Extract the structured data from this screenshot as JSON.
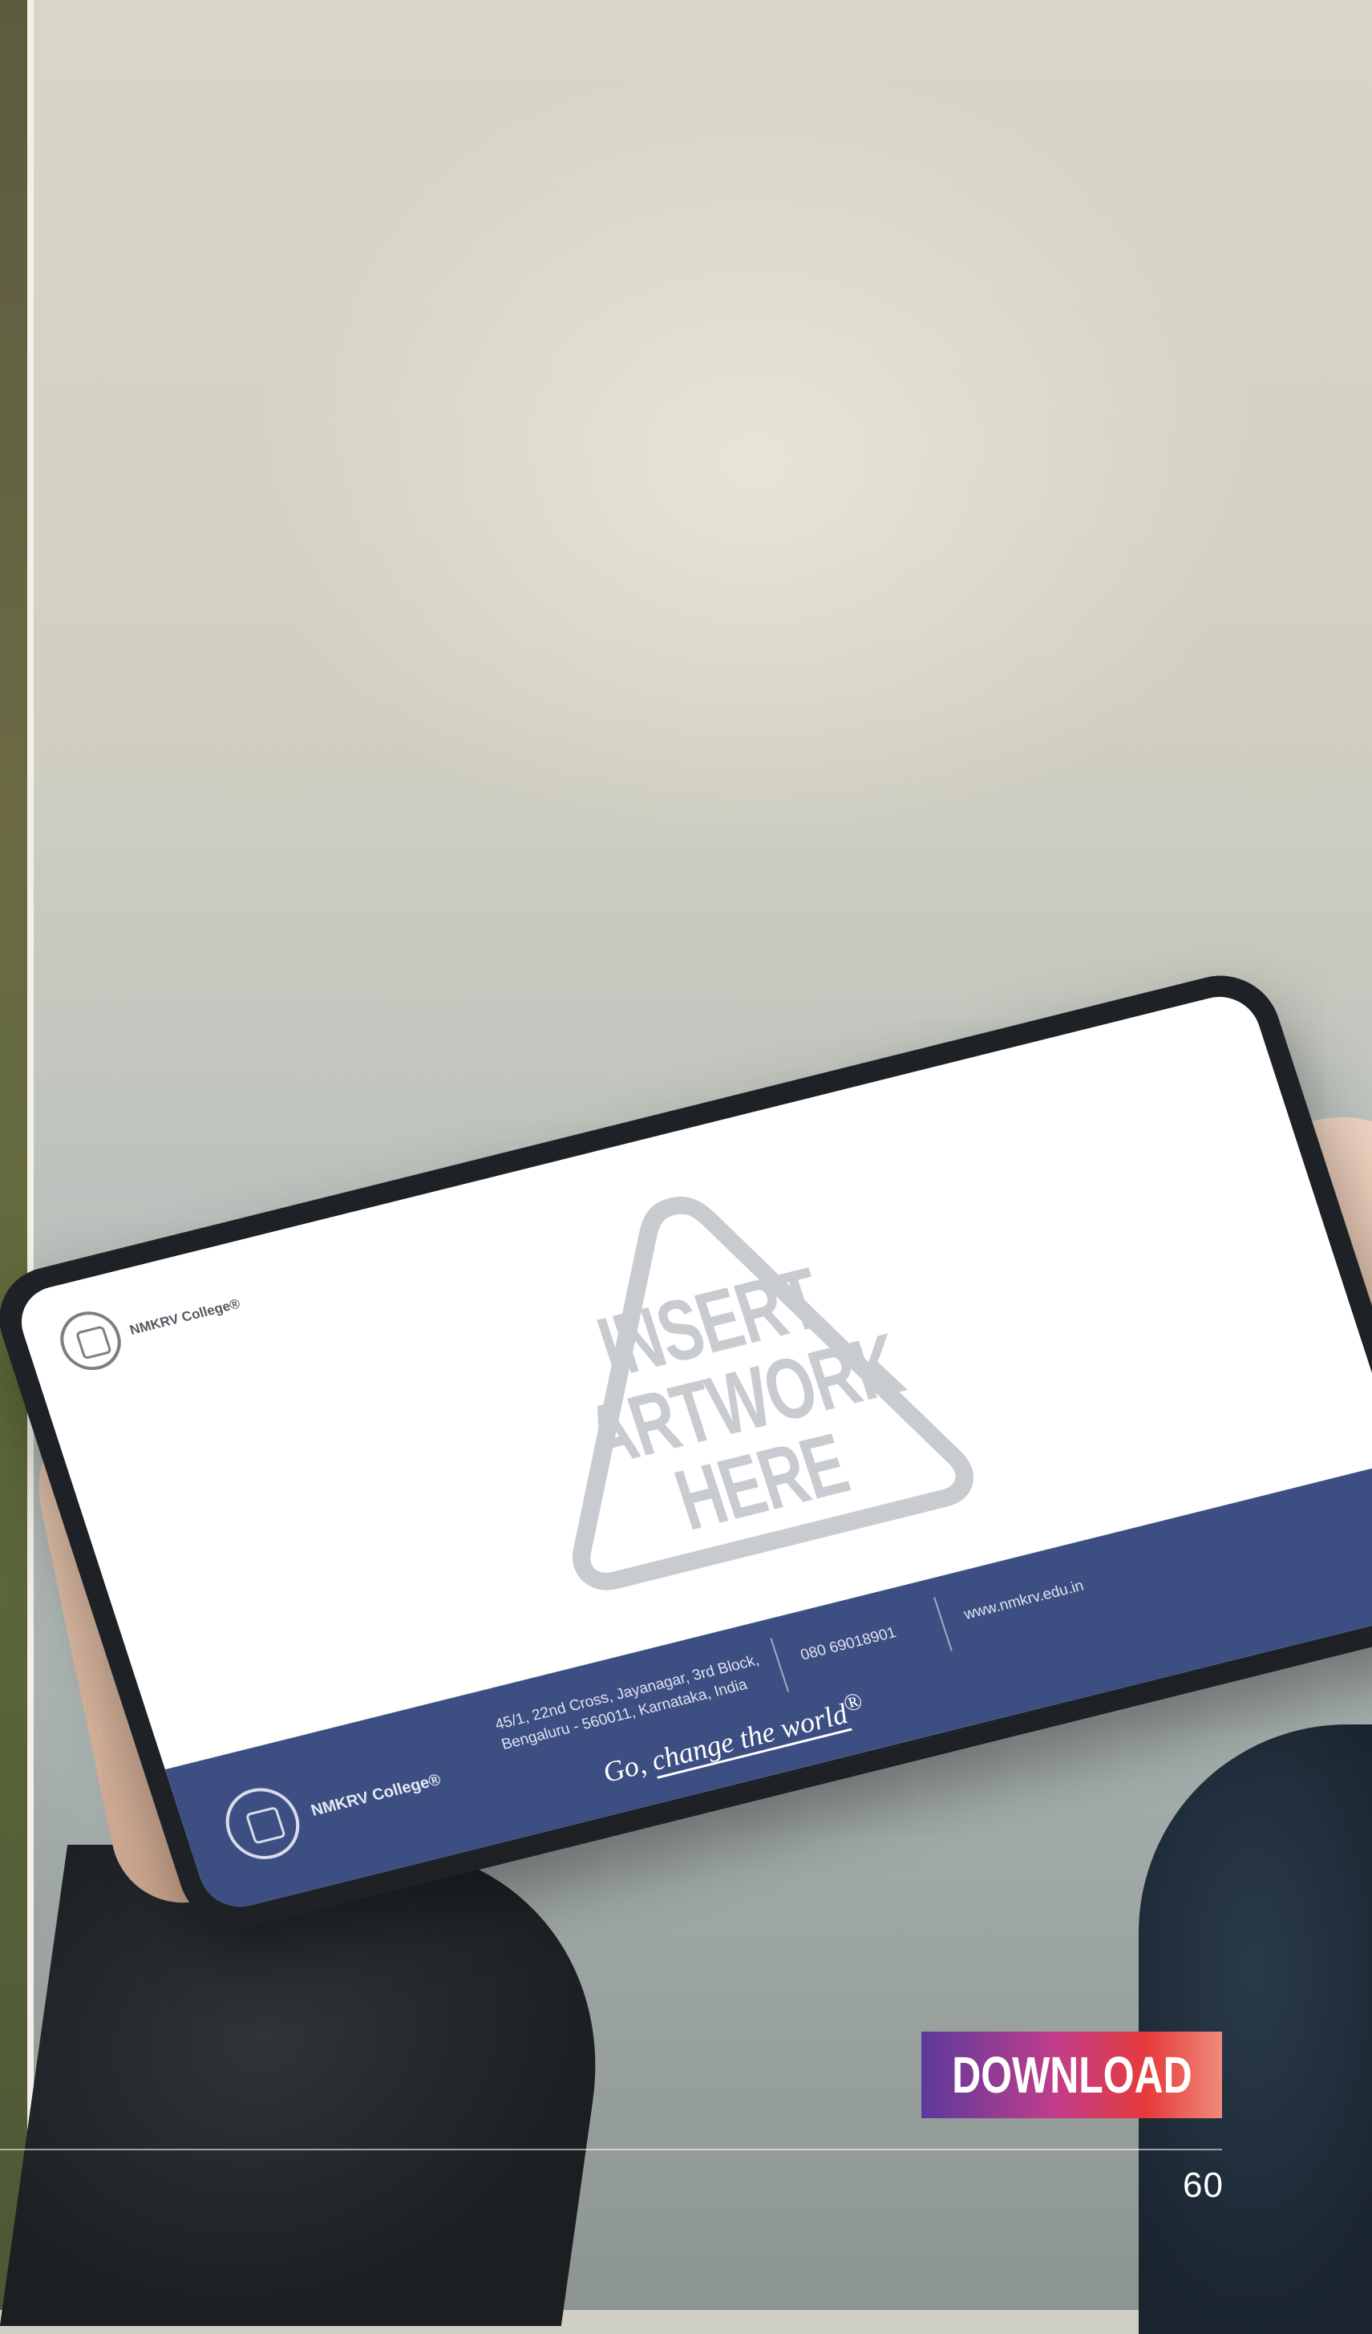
{
  "tablet_screen": {
    "header_logo_text": "NMKRV College®",
    "artwork_placeholder": [
      "INSERT",
      "ARTWORK",
      "HERE"
    ],
    "footer": {
      "college_name": "NMKRV College®",
      "address_line1": "45/1, 22nd Cross, Jayanagar, 3rd Block,",
      "address_line2": "Bengaluru - 560011, Karnataka, India",
      "phone": "080 69018901",
      "website": "www.nmkrv.edu.in",
      "tagline_prefix": "Go, ",
      "tagline_emphasis": "change the world",
      "tagline_mark": "®",
      "brand_color": "#3d4f82"
    }
  },
  "download_button": {
    "label": "DOWNLOAD"
  },
  "page_number": "60"
}
